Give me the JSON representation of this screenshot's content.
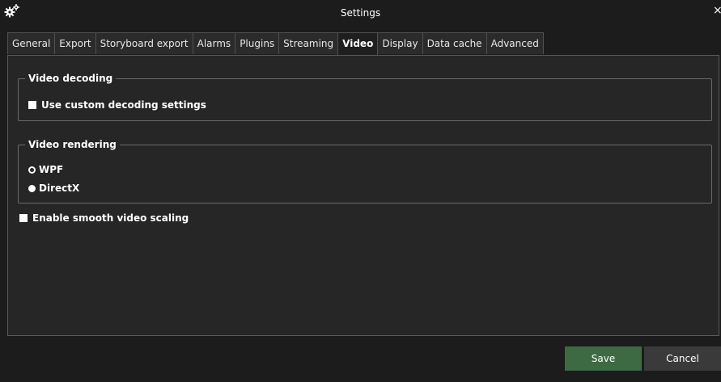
{
  "window": {
    "title": "Settings",
    "close_glyph": "×",
    "icon": "gears-icon"
  },
  "tabs": [
    {
      "label": "General",
      "active": false
    },
    {
      "label": "Export",
      "active": false
    },
    {
      "label": "Storyboard export",
      "active": false
    },
    {
      "label": "Alarms",
      "active": false
    },
    {
      "label": "Plugins",
      "active": false
    },
    {
      "label": "Streaming",
      "active": false
    },
    {
      "label": "Video",
      "active": true
    },
    {
      "label": "Display",
      "active": false
    },
    {
      "label": "Data cache",
      "active": false
    },
    {
      "label": "Advanced",
      "active": false
    }
  ],
  "video_decoding": {
    "legend": "Video decoding",
    "custom_decoding": {
      "label": "Use custom decoding settings",
      "checked": false
    }
  },
  "video_rendering": {
    "legend": "Video rendering",
    "options": [
      {
        "label": "WPF",
        "selected": false
      },
      {
        "label": "DirectX",
        "selected": true
      }
    ]
  },
  "smooth_scaling": {
    "label": "Enable smooth video scaling",
    "checked": false
  },
  "buttons": {
    "save_label": "Save",
    "cancel_label": "Cancel"
  },
  "colors": {
    "background": "#1c1c1c",
    "panel": "#262626",
    "save_button": "#3d6a43",
    "cancel_button": "#3a3a3a"
  }
}
